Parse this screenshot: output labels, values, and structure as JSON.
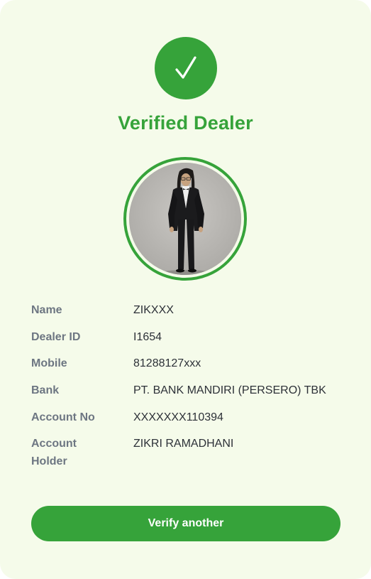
{
  "colors": {
    "accent": "#36a33a",
    "background": "#f5fbea",
    "label": "#6d7682",
    "value": "#2d3138"
  },
  "header": {
    "icon": "check-icon",
    "title": "Verified Dealer"
  },
  "avatar": {
    "icon": "profile-photo"
  },
  "details": [
    {
      "label": "Name",
      "value": "ZIKXXX"
    },
    {
      "label": "Dealer ID",
      "value": "I1654"
    },
    {
      "label": "Mobile",
      "value": "81288127xxx"
    },
    {
      "label": "Bank",
      "value": "PT. BANK MANDIRI (PERSERO) TBK"
    },
    {
      "label": "Account No",
      "value": "XXXXXXX110394"
    },
    {
      "label": "Account Holder",
      "value": "ZIKRI RAMADHANI"
    }
  ],
  "actions": {
    "verify_label": "Verify another"
  }
}
